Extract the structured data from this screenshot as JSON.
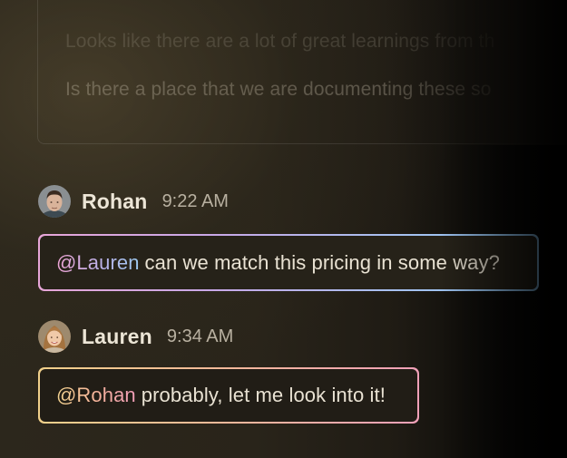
{
  "previous_message": {
    "line1": "Looks like there are a lot of great learnings from th",
    "line2": "Is there a place that we are documenting these so"
  },
  "messages": [
    {
      "author": "Rohan",
      "time": "9:22 AM",
      "mention": "@Lauren",
      "text": "can we match this pricing in some way?"
    },
    {
      "author": "Lauren",
      "time": "9:34 AM",
      "mention": "@Rohan",
      "text": "probably, let me look into it!"
    }
  ],
  "colors": {
    "background": "#29241a",
    "author_text": "#ece5d6",
    "time_text": "#b8b0a0",
    "message_text": "#e9e2d3",
    "bubble1_gradient": [
      "#e7a6d8",
      "#a8c0f0",
      "#8ec8f4"
    ],
    "bubble2_gradient": [
      "#f1d08a",
      "#f4b89a",
      "#f0a0b8"
    ]
  },
  "icons": {
    "rohan_avatar": "avatar-rohan",
    "lauren_avatar": "avatar-lauren"
  }
}
